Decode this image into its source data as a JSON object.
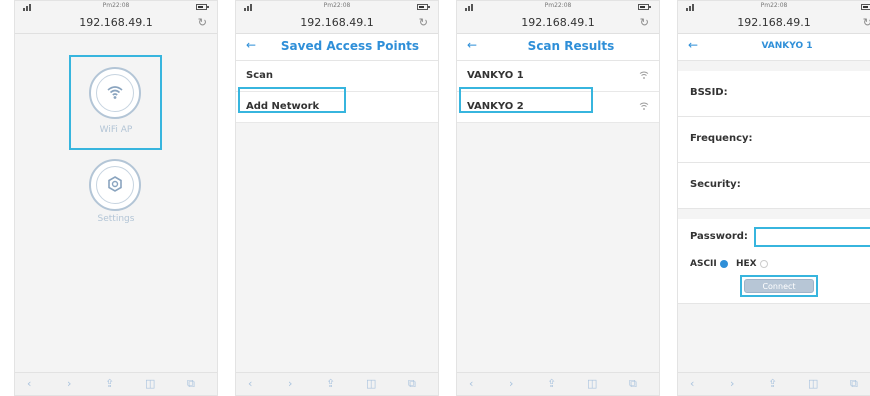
{
  "status_bar": {
    "time": "Pm22:08"
  },
  "browser": {
    "address": "192.168.49.1"
  },
  "screen1": {
    "wifi_ap_label": "WiFi AP",
    "settings_label": "Settings"
  },
  "screen2": {
    "title": "Saved Access Points",
    "items": [
      "Scan",
      "Add Network"
    ]
  },
  "screen3": {
    "title": "Scan Results",
    "items": [
      "VANKYO 1",
      "VANKYO 2"
    ]
  },
  "screen4": {
    "title": "VANKYO 1",
    "bssid_label": "BSSID:",
    "frequency_label": "Frequency:",
    "security_label": "Security:",
    "password_label": "Password:",
    "ascii_label": "ASCII",
    "hex_label": "HEX",
    "connect_label": "Connect",
    "password_value": ""
  },
  "colors": {
    "accent": "#2f8fd8",
    "highlight": "#37b5de",
    "icon_gray": "#b3c5d6"
  }
}
